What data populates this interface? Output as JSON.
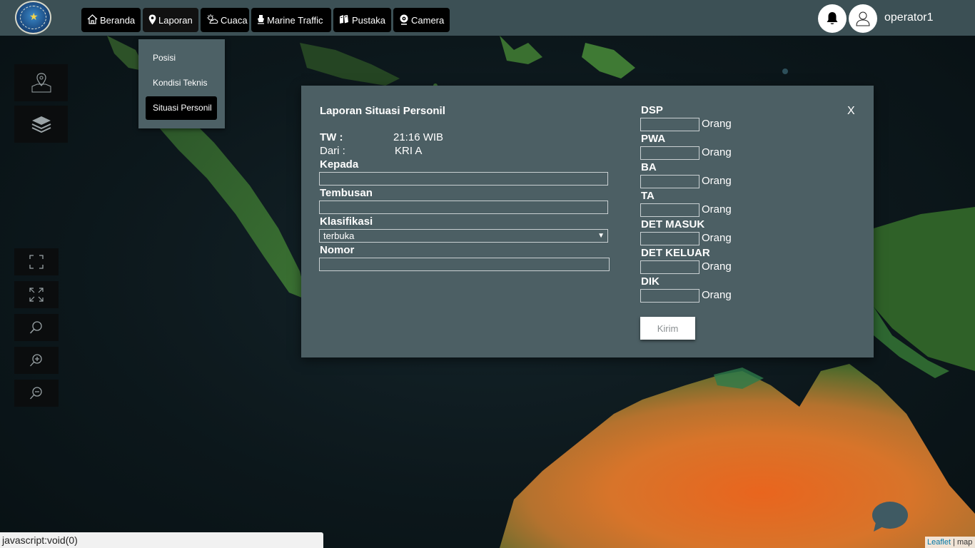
{
  "nav": {
    "items": [
      {
        "label": "Beranda"
      },
      {
        "label": "Laporan"
      },
      {
        "label": "Cuaca"
      },
      {
        "label": "Marine Traffic"
      },
      {
        "label": "Pustaka"
      },
      {
        "label": "Camera"
      }
    ]
  },
  "user": {
    "name": "operator1"
  },
  "laporan_menu": {
    "items": [
      {
        "label": "Posisi"
      },
      {
        "label": "Kondisi Teknis"
      },
      {
        "label": "Situasi Personil"
      }
    ],
    "selected": "Situasi Personil"
  },
  "form": {
    "title": "Laporan Situasi Personil",
    "close": "X",
    "tw_label": "TW :",
    "tw_value": "21:16 WIB",
    "dari_label": "Dari :",
    "dari_value": "KRI A",
    "kepada_label": "Kepada",
    "kepada_value": "",
    "tembusan_label": "Tembusan",
    "tembusan_value": "",
    "klasifikasi_label": "Klasifikasi",
    "klasifikasi_value": "terbuka",
    "nomor_label": "Nomor",
    "nomor_value": "",
    "unit": "Orang",
    "counts": [
      {
        "label": "DSP",
        "value": ""
      },
      {
        "label": "PWA",
        "value": ""
      },
      {
        "label": "BA",
        "value": ""
      },
      {
        "label": "TA",
        "value": ""
      },
      {
        "label": "DET MASUK",
        "value": ""
      },
      {
        "label": "DET KELUAR",
        "value": ""
      },
      {
        "label": "DIK",
        "value": ""
      }
    ],
    "submit": "Kirim"
  },
  "status_bar": "javascript:void(0)",
  "attribution": {
    "leaflet": "Leaflet",
    "sep": "|",
    "map": "map"
  },
  "colors": {
    "topbar": "#3c5055",
    "modal": "#4c5f64",
    "button": "#000000"
  }
}
